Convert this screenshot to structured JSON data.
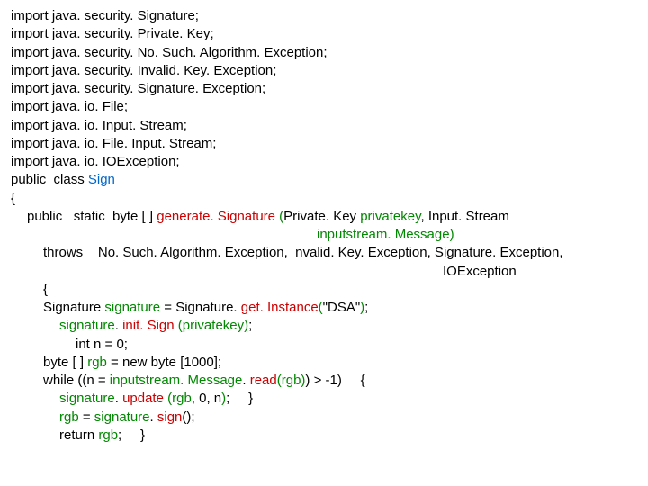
{
  "lines": {
    "l1": "import java. security. Signature;",
    "l2": "import java. security. Private. Key;",
    "l3": "import java. security. No. Such. Algorithm. Exception;",
    "l4": "import java. security. Invalid. Key. Exception;",
    "l5": "import java. security. Signature. Exception;",
    "l6": "import java. io. File;",
    "l7": "import java. io. Input. Stream;",
    "l8": "import java. io. File. Input. Stream;",
    "l9": "import java. io. IOException;",
    "l10a": "public  class ",
    "l10b": "Sign",
    "l11": "{",
    "l12a": "public   static  byte [ ] ",
    "l12b": "generate. Signature ",
    "l12c": "(",
    "l12d": "Private. Key ",
    "l12e": "privatekey",
    "l12f": ", Input. Stream",
    "l13a": "inputstream. Message",
    "l13b": ")",
    "l14a": "throws    ",
    "l14b": "No. Such. Algorithm. Exception,  nvalid. Key. Exception, Signature. Exception,",
    "l15": "IOException",
    "l16": "{",
    "l17a": "Signature ",
    "l17b": "signature",
    "l17c": " = Signature. ",
    "l17d": "get. Instance",
    "l17e": "(",
    "l17f": "\"DSA\"",
    "l17g": ")",
    "l17h": ";",
    "l18a": "signature",
    "l18b": ". ",
    "l18c": "init. Sign ",
    "l18d": "(",
    "l18e": "privatekey",
    "l18f": ")",
    "l18g": ";",
    "l19": "int n = 0;",
    "l20a": "byte [ ] ",
    "l20b": "rgb",
    "l20c": " = new byte [1000];",
    "l21a": "while ((n = ",
    "l21b": "inputstream. Message",
    "l21c": ". ",
    "l21d": "read",
    "l21e": "(",
    "l21f": "rgb",
    "l21g": ")",
    "l21h": ") > -1)     {",
    "l22a": "signature",
    "l22b": ". ",
    "l22c": "update ",
    "l22d": "(",
    "l22e": "rgb",
    "l22f": ", 0, n",
    "l22g": ")",
    "l22h": ";     }",
    "l23a": "rgb",
    "l23b": " = ",
    "l23c": "signature",
    "l23d": ". ",
    "l23e": "sign",
    "l23f": "();",
    "l24a": "return ",
    "l24b": "rgb",
    "l24c": ";     }"
  }
}
